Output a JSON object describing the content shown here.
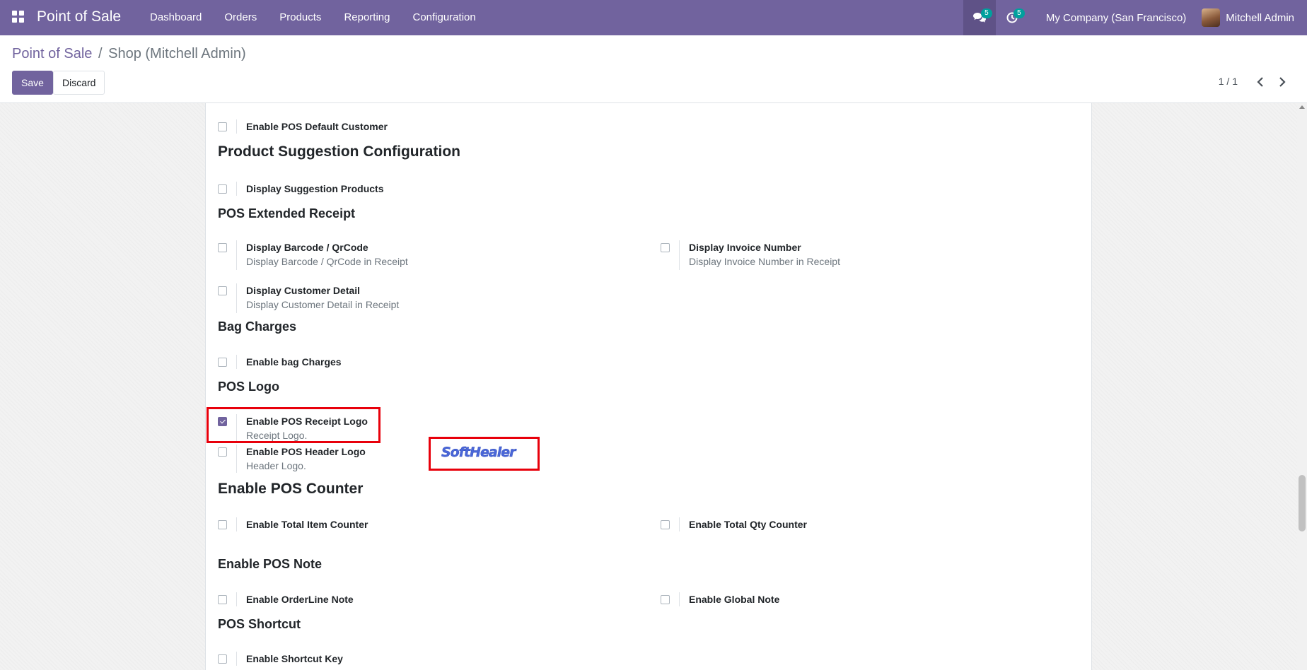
{
  "navbar": {
    "brand": "Point of Sale",
    "menu": [
      "Dashboard",
      "Orders",
      "Products",
      "Reporting",
      "Configuration"
    ],
    "messages_count": "5",
    "activities_count": "5",
    "company": "My Company (San Francisco)",
    "user": "Mitchell Admin"
  },
  "breadcrumb": {
    "parent": "Point of Sale",
    "separator": "/",
    "current": "Shop (Mitchell Admin)"
  },
  "actions": {
    "save": "Save",
    "discard": "Discard"
  },
  "pager": {
    "value": "1 / 1"
  },
  "sections": {
    "default_customer": {
      "label": "Enable POS Default Customer",
      "checked": false
    },
    "product_suggestion": {
      "title": "Product Suggestion Configuration",
      "display_suggestion": {
        "label": "Display Suggestion Products",
        "checked": false
      }
    },
    "extended_receipt": {
      "title": "POS Extended Receipt",
      "barcode": {
        "label": "Display Barcode / QrCode",
        "help": "Display Barcode / QrCode in Receipt",
        "checked": false
      },
      "invoice_number": {
        "label": "Display Invoice Number",
        "help": "Display Invoice Number in Receipt",
        "checked": false
      },
      "customer_detail": {
        "label": "Display Customer Detail",
        "help": "Display Customer Detail in Receipt",
        "checked": false
      }
    },
    "bag_charges": {
      "title": "Bag Charges",
      "enable": {
        "label": "Enable bag Charges",
        "checked": false
      }
    },
    "pos_logo": {
      "title": "POS Logo",
      "receipt_logo": {
        "label": "Enable POS Receipt Logo",
        "help": "Receipt Logo.",
        "checked": true
      },
      "header_logo": {
        "label": "Enable POS Header Logo",
        "help": "Header Logo.",
        "checked": false
      },
      "logo_image_text": "SoftHealer"
    },
    "pos_counter": {
      "title": "Enable POS Counter",
      "total_item": {
        "label": "Enable Total Item Counter",
        "checked": false
      },
      "total_qty": {
        "label": "Enable Total Qty Counter",
        "checked": false
      }
    },
    "pos_note": {
      "title": "Enable POS Note",
      "orderline_note": {
        "label": "Enable OrderLine Note",
        "checked": false
      },
      "global_note": {
        "label": "Enable Global Note",
        "checked": false
      }
    },
    "pos_shortcut": {
      "title": "POS Shortcut",
      "shortcut_key": {
        "label": "Enable Shortcut Key",
        "checked": false
      }
    }
  },
  "colors": {
    "brand": "#71639e",
    "highlight": "#e8000b",
    "badge": "#00a09d"
  }
}
